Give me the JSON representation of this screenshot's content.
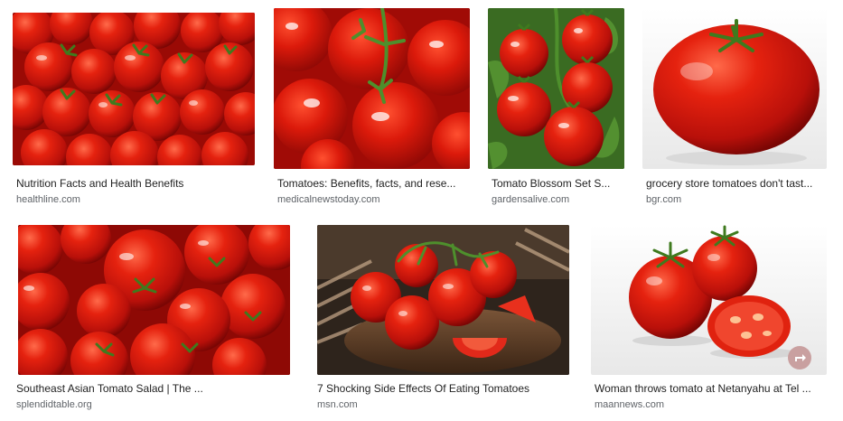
{
  "results": [
    {
      "title": "Nutrition Facts and Health Benefits",
      "source": "healthline.com"
    },
    {
      "title": "Tomatoes: Benefits, facts, and rese...",
      "source": "medicalnewstoday.com"
    },
    {
      "title": "Tomato Blossom Set S...",
      "source": "gardensalive.com"
    },
    {
      "title": "grocery store tomatoes don't tast...",
      "source": "bgr.com"
    },
    {
      "title": "Southeast Asian Tomato Salad | The ...",
      "source": "splendidtable.org"
    },
    {
      "title": "7 Shocking Side Effects Of Eating Tomatoes",
      "source": "msn.com"
    },
    {
      "title": "Woman throws tomato at Netanyahu at Tel ...",
      "source": "maannews.com"
    }
  ],
  "colors": {
    "tomato_red": "#d8160c",
    "tomato_dark": "#9e0a05",
    "stem_green": "#3f7a1e",
    "leaf_green": "#4e8f2c",
    "wood_brown": "#5a3a22",
    "title_text": "#222222",
    "source_text": "#5f6368"
  },
  "icons": {
    "share_badge": "share-icon"
  }
}
